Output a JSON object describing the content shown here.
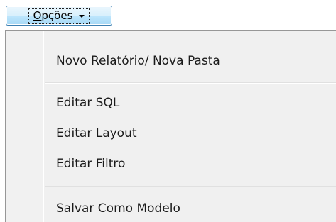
{
  "button": {
    "label_mnemonic": "O",
    "label_rest": "pções"
  },
  "menu": {
    "items": [
      {
        "label": "Novo Relatório/ Nova Pasta"
      },
      {
        "label": "Editar SQL"
      },
      {
        "label": "Editar Layout"
      },
      {
        "label": "Editar Filtro"
      },
      {
        "label": "Salvar Como Modelo"
      }
    ]
  }
}
